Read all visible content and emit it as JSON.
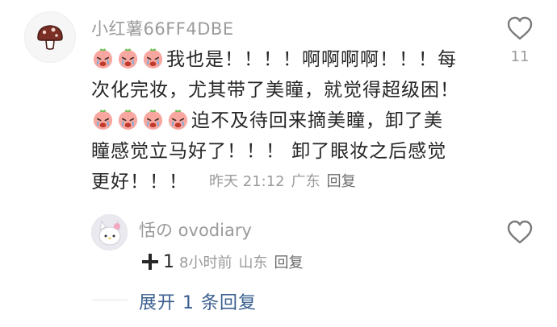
{
  "comment": {
    "avatar_icon": "mushroom-icon",
    "username": "小红薯66FF4DBE",
    "line1_text": "我也是！！！！啊啊啊啊！！！每",
    "line2_text": "次化完妆，尤其带了美瞳，就觉得超级困！",
    "line3_text": "迫不及待回来摘美瞳，卸了美",
    "line4_text": "瞳感觉立马好了！！！ 卸了眼妆之后感觉",
    "line5_text": "更好！！！",
    "emoji_name": "crying-face-emoji",
    "time": "昨天 21:12",
    "location": "广东",
    "reply_label": "回复",
    "like_icon": "heart-outline-icon",
    "like_count": "11"
  },
  "sub_comment": {
    "avatar_icon": "hello-kitty-avatar",
    "username": "恬の ovodiary",
    "plus_icon": "plus-icon",
    "plus_count": "1",
    "time": "8小时前",
    "location": "山东",
    "reply_label": "回复",
    "like_icon": "heart-outline-icon"
  },
  "expand_replies": {
    "label": "展开 1 条回复"
  },
  "colors": {
    "text_primary": "#262626",
    "text_secondary": "#9b9b9b",
    "link_blue": "#3a5f8f"
  }
}
